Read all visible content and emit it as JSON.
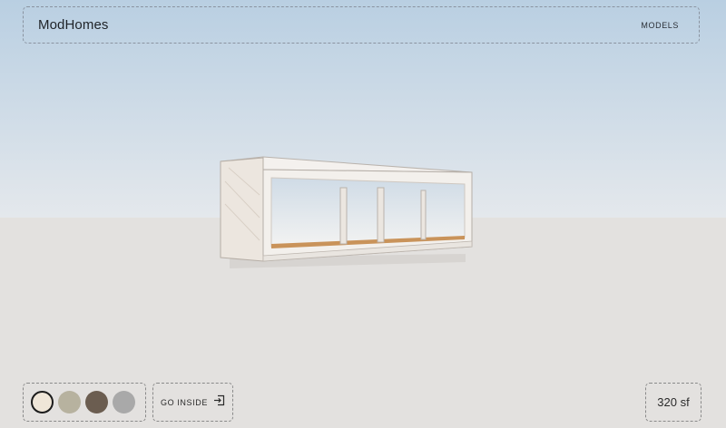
{
  "header": {
    "brand": "ModHomes",
    "nav_models": "MODELS"
  },
  "scene": {
    "sky_top_color": "#b9cfe2",
    "sky_bottom_color": "#e4e8ec",
    "ground_color": "#e3e1df",
    "floor_color": "#c9935a"
  },
  "controls": {
    "swatches": [
      {
        "name": "cream",
        "color": "#efe6d8",
        "selected": true
      },
      {
        "name": "stone",
        "color": "#b7b29f",
        "selected": false
      },
      {
        "name": "brown",
        "color": "#6b5d50",
        "selected": false
      },
      {
        "name": "gray",
        "color": "#a9a9a9",
        "selected": false
      }
    ],
    "go_inside_label": "GO INSIDE",
    "go_inside_icon": "enter-icon"
  },
  "area": {
    "label": "320 sf"
  }
}
